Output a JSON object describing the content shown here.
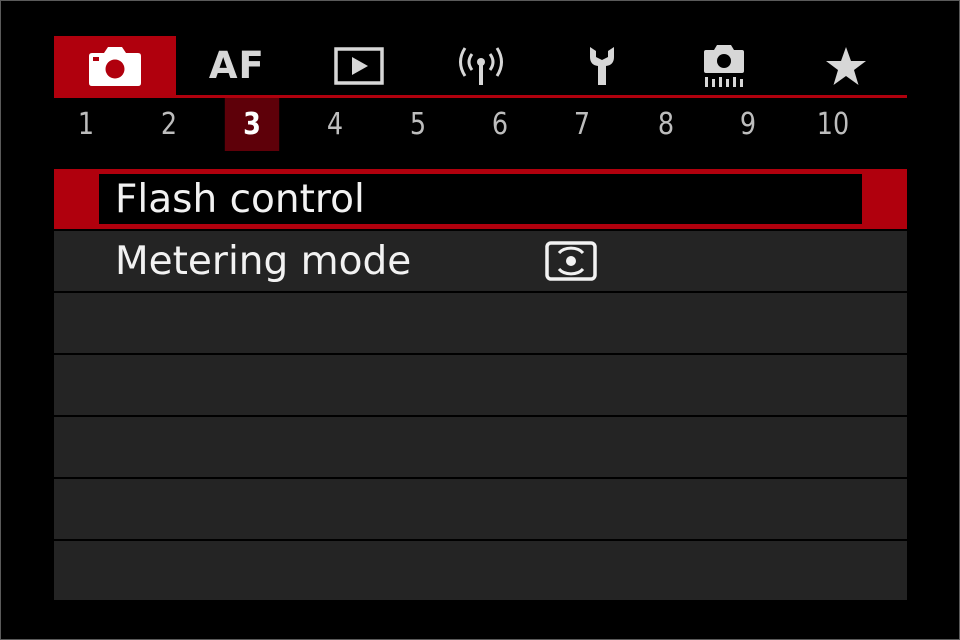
{
  "tabs": [
    {
      "id": "shooting",
      "icon": "camera-icon",
      "active": true
    },
    {
      "id": "af",
      "label": "AF",
      "active": false
    },
    {
      "id": "playback",
      "icon": "play-icon",
      "active": false
    },
    {
      "id": "wireless",
      "icon": "wireless-icon",
      "active": false
    },
    {
      "id": "setup",
      "icon": "wrench-icon",
      "active": false
    },
    {
      "id": "custom",
      "icon": "custom-function-icon",
      "active": false
    },
    {
      "id": "my-menu",
      "icon": "star-icon",
      "active": false
    }
  ],
  "pages": [
    "1",
    "2",
    "3",
    "4",
    "5",
    "6",
    "7",
    "8",
    "9",
    "10"
  ],
  "active_page": "3",
  "menu": {
    "items": [
      {
        "label": "Flash control",
        "selected": true
      },
      {
        "label": "Metering mode",
        "value_icon": "evaluative-metering-icon",
        "selected": false
      },
      {
        "label": "",
        "selected": false
      },
      {
        "label": "",
        "selected": false
      },
      {
        "label": "",
        "selected": false
      },
      {
        "label": "",
        "selected": false
      },
      {
        "label": "",
        "selected": false
      }
    ]
  },
  "colors": {
    "accent": "#b0000d",
    "page_active": "#5e0009",
    "row": "#242424",
    "text": "#f2f2f2"
  }
}
